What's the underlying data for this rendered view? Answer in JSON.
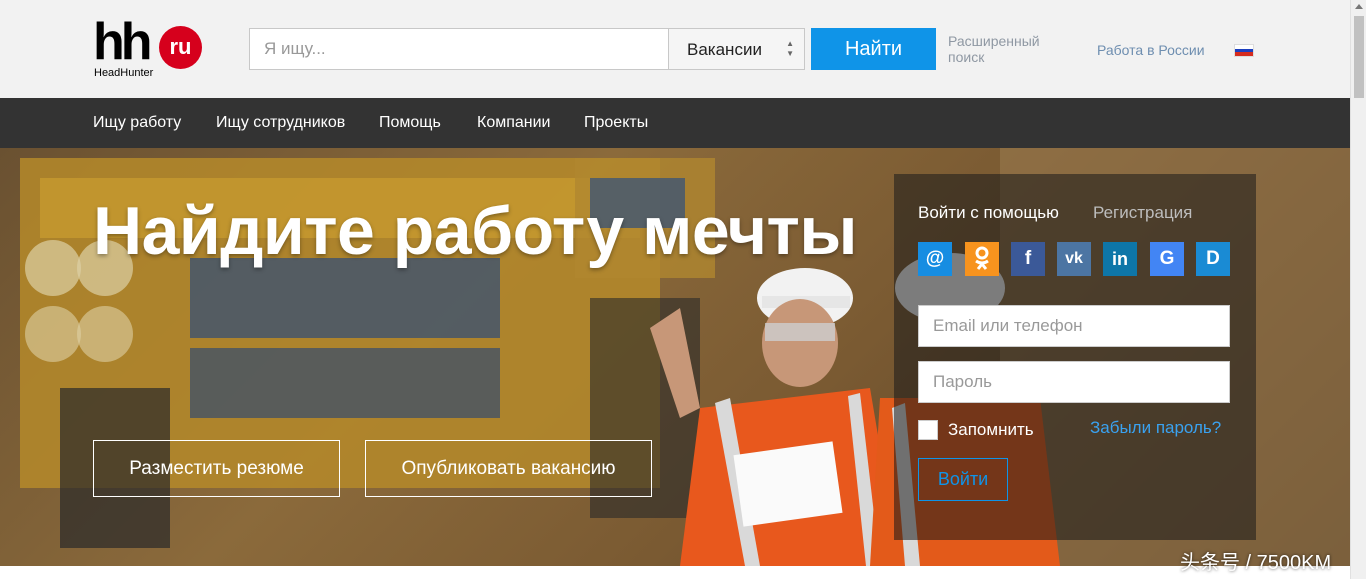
{
  "header": {
    "logo": {
      "main": "hh",
      "badge": "ru",
      "sub": "HeadHunter"
    },
    "search": {
      "placeholder": "Я ищу..."
    },
    "category": {
      "selected": "Вакансии"
    },
    "find_label": "Найти",
    "advanced_search": "Расширенный поиск",
    "region_link": "Работа в России",
    "flag_icon": "russia-flag-icon"
  },
  "nav": {
    "items": [
      {
        "label": "Ищу работу"
      },
      {
        "label": "Ищу сотрудников"
      },
      {
        "label": "Помощь"
      },
      {
        "label": "Компании"
      },
      {
        "label": "Проекты"
      }
    ]
  },
  "hero": {
    "title": "Найдите работу мечты",
    "post_resume": "Разместить резюме",
    "publish_vacancy": "Опубликовать вакансию"
  },
  "login": {
    "tab_login": "Войти с помощью",
    "tab_register": "Регистрация",
    "social": [
      {
        "name": "mailru-icon",
        "glyph": "@",
        "color": "#168de2"
      },
      {
        "name": "odnoklassniki-icon",
        "glyph": "ok",
        "color": "#f7931e"
      },
      {
        "name": "facebook-icon",
        "glyph": "f",
        "color": "#3b5998"
      },
      {
        "name": "vk-icon",
        "glyph": "vk",
        "color": "#4c75a3"
      },
      {
        "name": "linkedin-icon",
        "glyph": "in",
        "color": "#0e76a8"
      },
      {
        "name": "google-icon",
        "glyph": "G",
        "color": "#4285f4"
      },
      {
        "name": "d-icon",
        "glyph": "D",
        "color": "#1a8bd4"
      }
    ],
    "email_placeholder": "Email или телефон",
    "password_placeholder": "Пароль",
    "remember": "Запомнить",
    "forgot": "Забыли пароль?",
    "submit": "Войти"
  },
  "watermark": "头条号 / 7500KM"
}
